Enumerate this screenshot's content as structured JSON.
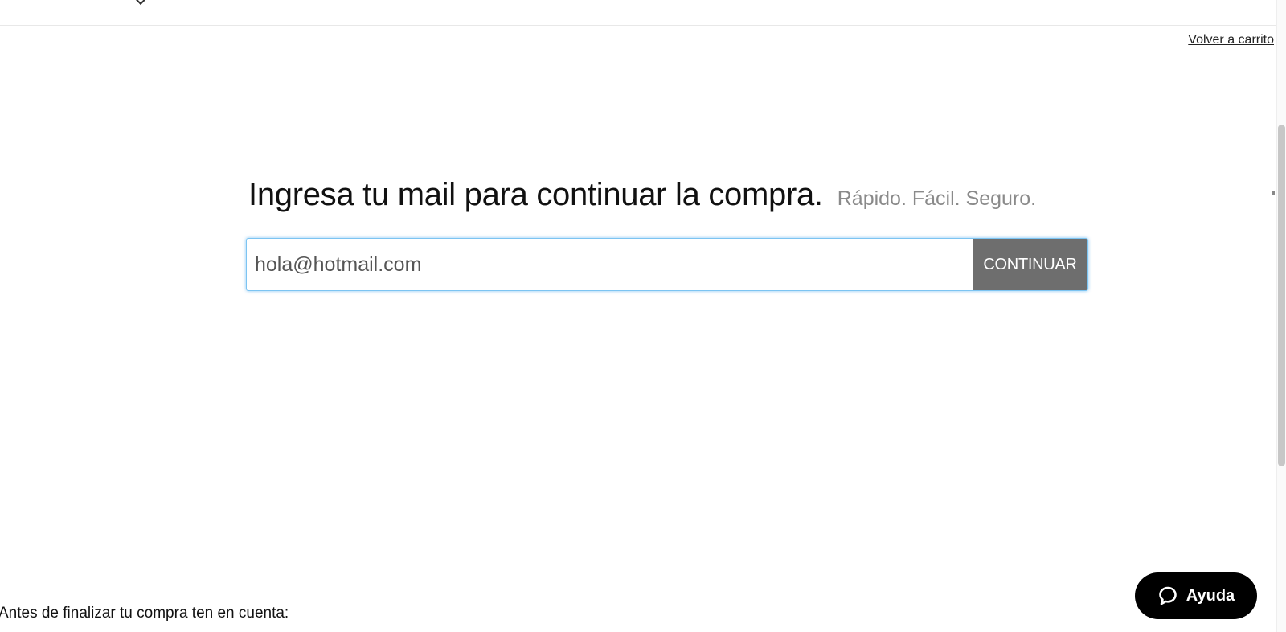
{
  "header": {
    "back_to_cart_label": "Volver a carrito"
  },
  "main": {
    "heading": "Ingresa tu mail para continuar la compra.",
    "subheading": "Rápido. Fácil. Seguro.",
    "email_value": "hola@hotmail.com",
    "continue_label": "CONTINUAR"
  },
  "footer": {
    "notice": "Antes de finalizar tu compra ten en cuenta:"
  },
  "help": {
    "label": "Ayuda",
    "icon": "chat-bubble-icon"
  },
  "colors": {
    "button_gray": "#6e6e6e",
    "focus_blue": "#7cc4f2",
    "help_black": "#000000",
    "subheading_gray": "#8a8a8a"
  }
}
